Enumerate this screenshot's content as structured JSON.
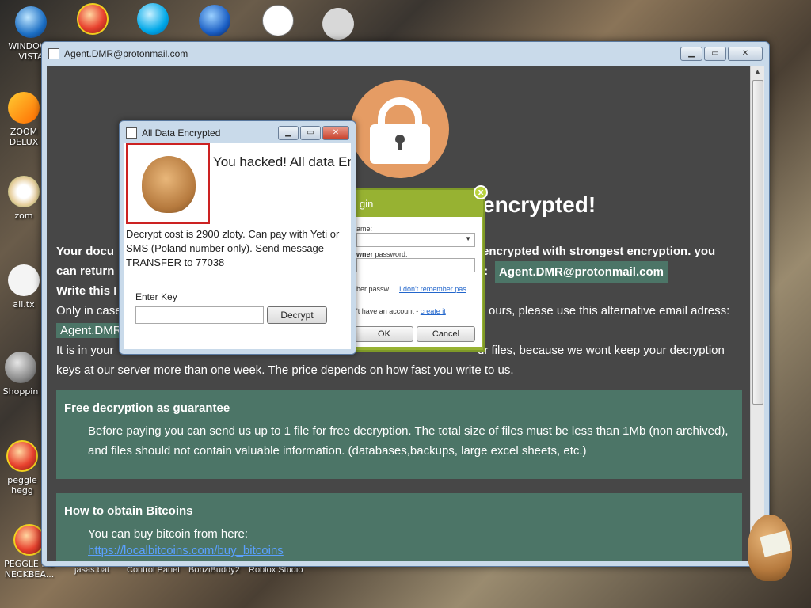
{
  "desktop": {
    "icons": [
      {
        "label": "WINDOWS VISTA",
        "icon": "windows-vista-icon"
      },
      {
        "label": "",
        "icon": "peggle-icon"
      },
      {
        "label": "",
        "icon": "skype-icon"
      },
      {
        "label": "",
        "icon": "internet-explorer-icon"
      },
      {
        "label": "",
        "icon": "calendar-icon"
      },
      {
        "label": "",
        "icon": "roblox-icon"
      },
      {
        "label": "ZOOM DELUX",
        "icon": "zoom-icon"
      },
      {
        "label": "zom",
        "icon": "flower-icon"
      },
      {
        "label": "all.tx",
        "icon": "text-file-icon"
      },
      {
        "label": "Shoppin",
        "icon": "flash-icon"
      },
      {
        "label": "peggle hegg",
        "icon": "peggle-icon"
      },
      {
        "label": "PEGGLE ME NECKBEA...",
        "icon": "peggle-icon"
      }
    ],
    "taskbar_labels": [
      "jasas.bat",
      "Control Panel",
      "BonziBuddy2",
      "Roblox Studio"
    ]
  },
  "main_window": {
    "title": "Agent.DMR@protonmail.com",
    "buttons": {
      "minimize": "▁",
      "maximize": "▭",
      "close": "✕"
    },
    "headline": "encrypted!",
    "line1_start": "Your docu",
    "line1_end": "encrypted with strongest encryption. you",
    "line2_start": "can return",
    "line2_mid": "l:",
    "email": "Agent.DMR@protonmail.com",
    "line3": "Write this I",
    "line4_start": "Only in case",
    "line4_end": "ours, please use this alternative email adress:",
    "line5_chip": "Agent.DMR",
    "line6_start": "It is in your",
    "line6_end": "ur files, because we wont keep your decryption",
    "line7": "keys at our server more than one week. The price depends on how fast you write to us.",
    "panel1": {
      "title": "Free decryption as guarantee",
      "text": "Before paying you can send us up to 1 file for free decryption. The total size of files must be less than 1Mb (non archived), and files should not contain valuable information. (databases,backups, large excel sheets, etc.)"
    },
    "panel2": {
      "title": "How to obtain Bitcoins",
      "text": "You can buy bitcoin from here:",
      "link": "https://localbitcoins.com/buy_bitcoins"
    }
  },
  "login_dialog": {
    "title": "gin",
    "close": "x",
    "name_label": "ame:",
    "password_label_bold": "wner",
    "password_label": " password:",
    "remember_label": "ber passw",
    "forgot_link": "I don't remember pas",
    "account_text": "'t have an account - ",
    "create_link": "create it",
    "ok": "OK",
    "cancel": "Cancel"
  },
  "enc_dialog": {
    "title": "All Data Encrypted",
    "heading": "You hacked! All data EnCrypted by ChomIk",
    "text": "Decrypt cost is 2900 zloty. Can pay with Yeti or SMS (Poland number only). Send message TRANSFER to 77038",
    "key_label": "Enter Key",
    "decrypt_button": "Decrypt"
  }
}
